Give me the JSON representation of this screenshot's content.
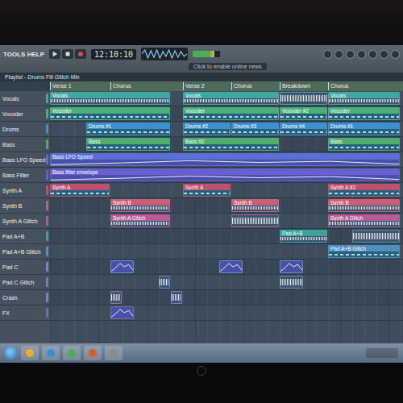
{
  "toolbar": {
    "menu": "TOOLS HELP",
    "time": "12:10:10",
    "hint": "Click to enable online news"
  },
  "playlist": {
    "title": "Playlist - Drums Fill Glitch Mix",
    "bars": 29,
    "markers": [
      {
        "label": "Verse 1",
        "bar": 0
      },
      {
        "label": "Chorus",
        "bar": 5
      },
      {
        "label": "Verse 2",
        "bar": 11
      },
      {
        "label": "Chorus",
        "bar": 15
      },
      {
        "label": "Breakdown",
        "bar": 19
      },
      {
        "label": "Chorus",
        "bar": 23
      }
    ],
    "tracks": [
      {
        "name": "Vocals",
        "color": "#3fa7a0",
        "clips": [
          {
            "kind": "audio",
            "start": 0,
            "length": 10,
            "label": "Vocals"
          },
          {
            "kind": "audio",
            "start": 11,
            "length": 8,
            "label": "Vocals"
          },
          {
            "kind": "audio",
            "start": 19,
            "length": 4
          },
          {
            "kind": "audio",
            "start": 23,
            "length": 6,
            "label": "Vocals"
          }
        ]
      },
      {
        "name": "Vocoder",
        "color": "#4caf7a",
        "clips": [
          {
            "kind": "pattern",
            "start": 0,
            "length": 10,
            "label": "Vocoder"
          },
          {
            "kind": "pattern",
            "start": 11,
            "length": 8,
            "label": "Vocoder"
          },
          {
            "kind": "pattern",
            "start": 19,
            "length": 4,
            "label": "Vocoder #2"
          },
          {
            "kind": "pattern",
            "start": 23,
            "length": 6,
            "label": "Vocoder"
          }
        ]
      },
      {
        "name": "Drums",
        "color": "#3d8fd0",
        "clips": [
          {
            "kind": "pattern",
            "start": 3,
            "length": 7,
            "label": "Drums #1"
          },
          {
            "kind": "pattern",
            "start": 11,
            "length": 4,
            "label": "Drums #2"
          },
          {
            "kind": "pattern",
            "start": 15,
            "length": 4,
            "label": "Drums #3"
          },
          {
            "kind": "pattern",
            "start": 19,
            "length": 4,
            "label": "Drums #4"
          },
          {
            "kind": "pattern",
            "start": 23,
            "length": 6,
            "label": "Drums #1"
          }
        ]
      },
      {
        "name": "Bass",
        "color": "#4fae6a",
        "clips": [
          {
            "kind": "pattern",
            "start": 3,
            "length": 7,
            "label": "Bass"
          },
          {
            "kind": "pattern",
            "start": 11,
            "length": 8,
            "label": "Bass #2"
          },
          {
            "kind": "pattern",
            "start": 23,
            "length": 6,
            "label": "Bass"
          }
        ]
      },
      {
        "name": "Bass LFO Speed",
        "color": "#5b6fd6",
        "clips": [
          {
            "kind": "automation",
            "start": 0,
            "length": 29,
            "label": "Bass LFO Speed"
          }
        ]
      },
      {
        "name": "Bass Filter",
        "color": "#6a5fd0",
        "clips": [
          {
            "kind": "automation",
            "start": 0,
            "length": 29,
            "label": "Bass filter envelope"
          }
        ]
      },
      {
        "name": "Synth A",
        "color": "#c05070",
        "clips": [
          {
            "kind": "pattern",
            "start": 0,
            "length": 5,
            "label": "Synth A"
          },
          {
            "kind": "pattern",
            "start": 11,
            "length": 4,
            "label": "Synth A"
          },
          {
            "kind": "pattern",
            "start": 23,
            "length": 6,
            "label": "Synth A #2"
          }
        ]
      },
      {
        "name": "Synth B",
        "color": "#c8607a",
        "clips": [
          {
            "kind": "audio",
            "start": 5,
            "length": 5,
            "label": "Synth B"
          },
          {
            "kind": "audio",
            "start": 15,
            "length": 4,
            "label": "Synth B"
          },
          {
            "kind": "audio",
            "start": 23,
            "length": 6,
            "label": "Synth B"
          }
        ]
      },
      {
        "name": "Synth A Glitch",
        "color": "#b85a9a",
        "clips": [
          {
            "kind": "audio",
            "start": 5,
            "length": 5,
            "label": "Synth A Glitch"
          },
          {
            "kind": "audio",
            "start": 15,
            "length": 4
          },
          {
            "kind": "audio",
            "start": 23,
            "length": 6,
            "label": "Synth A Glitch"
          }
        ]
      },
      {
        "name": "Pad A+B",
        "color": "#3aa39a",
        "clips": [
          {
            "kind": "audio",
            "start": 19,
            "length": 4,
            "label": "Pad A+B"
          },
          {
            "kind": "audio",
            "start": 25,
            "length": 4
          }
        ]
      },
      {
        "name": "Pad A+B Glitch",
        "color": "#4f8fc0",
        "clips": [
          {
            "kind": "pattern",
            "start": 23,
            "length": 6,
            "label": "Pad A+B Glitch"
          }
        ]
      },
      {
        "name": "Pad C",
        "color": "#6a8ac8",
        "clips": [
          {
            "kind": "automation",
            "start": 5,
            "length": 2
          },
          {
            "kind": "automation",
            "start": 14,
            "length": 2
          },
          {
            "kind": "automation",
            "start": 19,
            "length": 2
          }
        ]
      },
      {
        "name": "Pad C Glitch",
        "color": "#7a7ac0",
        "clips": [
          {
            "kind": "audio",
            "start": 9,
            "length": 1
          },
          {
            "kind": "audio",
            "start": 19,
            "length": 2
          }
        ]
      },
      {
        "name": "Crash",
        "color": "#8a7ab8",
        "clips": [
          {
            "kind": "audio",
            "start": 5,
            "length": 1
          },
          {
            "kind": "audio",
            "start": 10,
            "length": 1
          }
        ]
      },
      {
        "name": "FX",
        "color": "#7a6aa8",
        "clips": [
          {
            "kind": "automation",
            "start": 5,
            "length": 2
          }
        ]
      }
    ]
  }
}
